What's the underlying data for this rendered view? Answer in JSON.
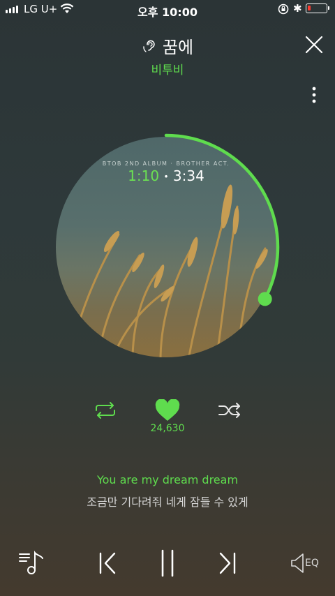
{
  "status_bar": {
    "carrier": "LG U+",
    "time": "오후 10:00",
    "bluetooth": "✱"
  },
  "player": {
    "song_title": "꿈에",
    "artist": "비투비",
    "album_caption": "BTOB 2ND ALBUM · BROTHER ACT.",
    "elapsed": "1:10",
    "separator": "•",
    "total": "3:34",
    "progress_fraction": 0.327,
    "like_count": "24,630",
    "lyric_current": "You are my dream dream",
    "lyric_next": "조금만 기다려줘 네게 잠들 수 있게",
    "eq_label": "EQ"
  },
  "colors": {
    "accent": "#5fdc4e",
    "battery_low": "#ff3b30"
  },
  "icons": {
    "close": "close-icon",
    "more": "more-vertical-icon",
    "repeat": "repeat-icon",
    "like": "heart-icon",
    "shuffle": "shuffle-icon",
    "playlist": "playlist-icon",
    "prev": "previous-icon",
    "pause": "pause-icon",
    "next": "next-icon",
    "eq": "equalizer-speaker-icon"
  }
}
